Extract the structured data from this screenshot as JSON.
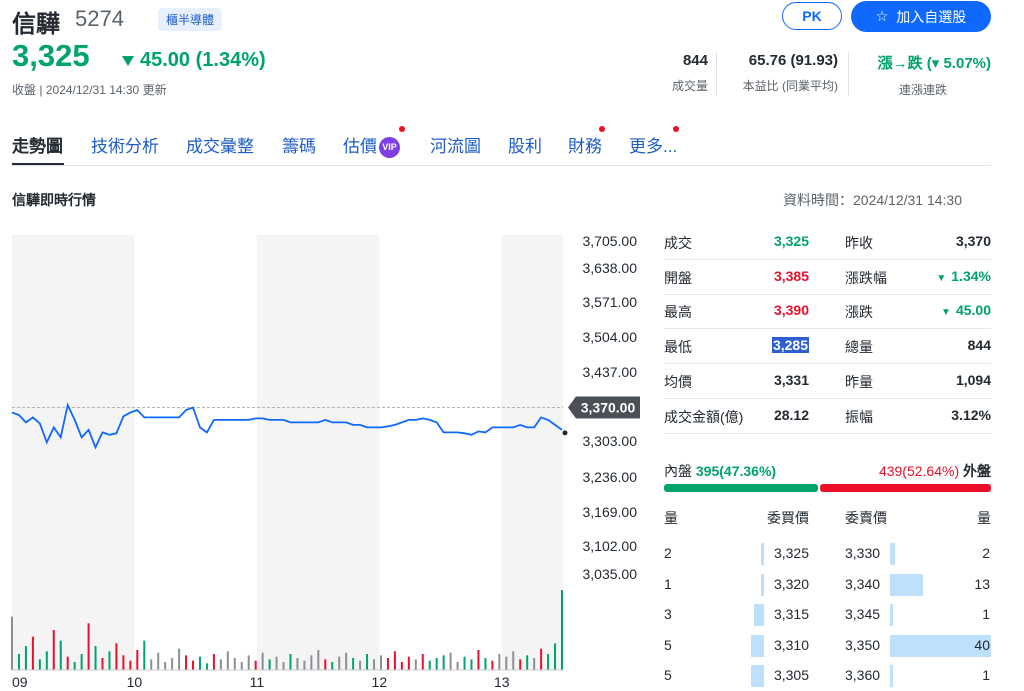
{
  "header": {
    "name": "信驊",
    "code": "5274",
    "market": "櫃半導體",
    "pk_label": "PK",
    "watch_label": "加入自選股",
    "price": "3,325",
    "change": "45.00 (1.34%)",
    "status_prefix": "收盤",
    "status_time": "2024/12/31 14:30 更新",
    "stats": [
      {
        "value": "844",
        "label": "成交量"
      },
      {
        "value": "65.76 (91.93)",
        "label": "本益比 (同業平均)"
      },
      {
        "value": "漲→跌 (▾ 5.07%)",
        "label": "連漲連跌"
      }
    ]
  },
  "tabs": [
    "走勢圖",
    "技術分析",
    "成交彙整",
    "籌碼",
    "估價",
    "河流圖",
    "股利",
    "財務",
    "更多..."
  ],
  "vip_label": "VIP",
  "section": {
    "title": "信驊即時行情",
    "data_time": "資料時間：2024/12/31 14:30"
  },
  "chart_data": {
    "type": "line",
    "x_ticks": [
      "09",
      "10",
      "11",
      "12",
      "13"
    ],
    "y_ticks": [
      "3,705.00",
      "3,638.00",
      "3,571.00",
      "3,504.00",
      "3,437.00",
      "3,303.00",
      "3,236.00",
      "3,169.00",
      "3,102.00",
      "3,035.00"
    ],
    "reference_label": "3,370.00",
    "reference_value": 3370,
    "ylim": [
      3035,
      3705
    ],
    "price_series": [
      3360,
      3355,
      3340,
      3350,
      3338,
      3300,
      3330,
      3310,
      3375,
      3345,
      3310,
      3325,
      3290,
      3320,
      3315,
      3318,
      3352,
      3360,
      3365,
      3350,
      3350,
      3350,
      3350,
      3350,
      3350,
      3365,
      3370,
      3330,
      3320,
      3345,
      3345,
      3345,
      3345,
      3345,
      3345,
      3348,
      3348,
      3345,
      3345,
      3345,
      3340,
      3340,
      3340,
      3340,
      3340,
      3345,
      3340,
      3340,
      3340,
      3335,
      3335,
      3330,
      3330,
      3330,
      3332,
      3335,
      3340,
      3345,
      3345,
      3348,
      3345,
      3340,
      3320,
      3320,
      3320,
      3318,
      3315,
      3322,
      3320,
      3330,
      3330,
      3330,
      3330,
      3335,
      3330,
      3330,
      3350,
      3345,
      3335,
      3325
    ],
    "volume_series": [
      40,
      12,
      18,
      25,
      8,
      14,
      30,
      22,
      10,
      6,
      12,
      35,
      18,
      9,
      14,
      20,
      11,
      7,
      15,
      22,
      8,
      13,
      6,
      9,
      16,
      11,
      7,
      10,
      5,
      12,
      8,
      14,
      9,
      6,
      11,
      7,
      13,
      8,
      10,
      6,
      12,
      9,
      7,
      11,
      15,
      8,
      6,
      10,
      13,
      9,
      7,
      12,
      8,
      11,
      9,
      14,
      6,
      10,
      8,
      12,
      7,
      9,
      11,
      13,
      6,
      10,
      8,
      15,
      9,
      7,
      12,
      10,
      14,
      8,
      11,
      9,
      16,
      12,
      20,
      60
    ]
  },
  "quote": [
    {
      "l1": "成交",
      "v1": "3,325",
      "l2": "昨收",
      "v2": "3,370"
    },
    {
      "l1": "開盤",
      "v1": "3,385",
      "l2": "漲跌幅",
      "v2": "1.34%"
    },
    {
      "l1": "最高",
      "v1": "3,390",
      "l2": "漲跌",
      "v2": "45.00"
    },
    {
      "l1": "最低",
      "v1": "3,285",
      "l2": "總量",
      "v2": "844"
    },
    {
      "l1": "均價",
      "v1": "3,331",
      "l2": "昨量",
      "v2": "1,094"
    },
    {
      "l1": "成交金額(億)",
      "v1": "28.12",
      "l2": "振幅",
      "v2": "3.12%"
    }
  ],
  "inner_outer": {
    "inner_label": "內盤",
    "inner_value": "395(47.36%)",
    "outer_value": "439(52.64%)",
    "outer_label": "外盤",
    "inner_fraction": 0.4736
  },
  "order_book": {
    "headers": [
      "量",
      "委買價",
      "委賣價",
      "量"
    ],
    "rows": [
      {
        "bid_vol": "2",
        "bid": "3,325",
        "ask": "3,330",
        "ask_vol": "2",
        "bid_level": 2,
        "ask_level": 2
      },
      {
        "bid_vol": "1",
        "bid": "3,320",
        "ask": "3,340",
        "ask_vol": "13",
        "bid_level": 1,
        "ask_level": 13
      },
      {
        "bid_vol": "3",
        "bid": "3,315",
        "ask": "3,345",
        "ask_vol": "1",
        "bid_level": 3,
        "ask_level": 1
      },
      {
        "bid_vol": "5",
        "bid": "3,310",
        "ask": "3,350",
        "ask_vol": "40",
        "bid_level": 5,
        "ask_level": 40
      },
      {
        "bid_vol": "5",
        "bid": "3,305",
        "ask": "3,360",
        "ask_vol": "1",
        "bid_level": 5,
        "ask_level": 1
      }
    ]
  },
  "colors": {
    "up": "#eb0f29",
    "down": "#00a36c",
    "line": "#0f69ff",
    "accent": "#0f69ff"
  }
}
